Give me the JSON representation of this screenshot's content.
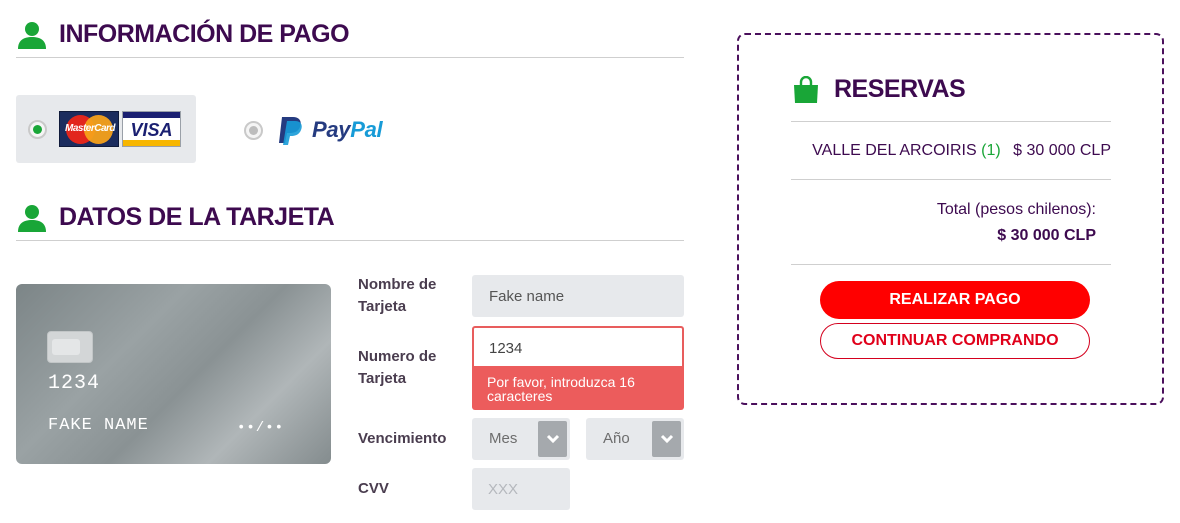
{
  "payment_info": {
    "title": "INFORMACIÓN DE PAGO",
    "methods": [
      {
        "name": "card",
        "logos": [
          "MasterCard",
          "VISA"
        ],
        "selected": true
      },
      {
        "name": "paypal",
        "logo_a": "Pay",
        "logo_b": "Pal",
        "selected": false
      }
    ]
  },
  "card_data": {
    "title": "DATOS DE LA TARJETA",
    "preview": {
      "number": "1234",
      "name": "FAKE NAME",
      "expiry": "••/••"
    },
    "fields": {
      "name_label": "Nombre de Tarjeta",
      "name_value": "Fake name",
      "number_label": "Numero de Tarjeta",
      "number_value": "1234",
      "number_error": "Por favor, introduzca 16 caracteres",
      "expiry_label": "Vencimiento",
      "month_value": "Mes",
      "year_value": "Año",
      "cvv_label": "CVV",
      "cvv_placeholder": "XXX"
    }
  },
  "summary": {
    "title": "RESERVAS",
    "item": {
      "name": "VALLE DEL ARCOIRIS",
      "qty": "(1)",
      "price": "$ 30 000 CLP"
    },
    "total_label": "Total (pesos chilenos):",
    "total_value": "$ 30 000 CLP",
    "pay_button": "REALIZAR PAGO",
    "continue_button": "CONTINUAR COMPRANDO"
  },
  "colors": {
    "heading": "#3d0a4f",
    "icon_green": "#19a637",
    "error": "#ec5c5c",
    "primary_button": "#ff0000"
  },
  "icons": [
    "user-icon",
    "shopping-bag-icon",
    "chevron-down-icon",
    "mastercard-logo",
    "visa-logo",
    "paypal-logo"
  ]
}
